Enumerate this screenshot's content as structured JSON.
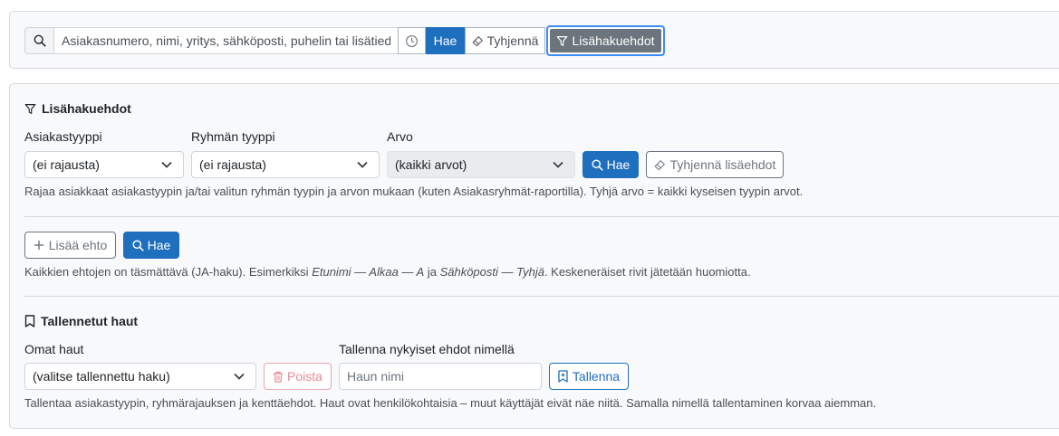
{
  "search": {
    "placeholder": "Asiakasnumero, nimi, yritys, sähköposti, puhelin tai lisätiedot",
    "hae_label": "Hae",
    "clear_label": "Tyhjennä",
    "advanced_label": "Lisähakuehdot"
  },
  "advanced": {
    "title": "Lisähakuehdot",
    "customer_type": {
      "label": "Asiakastyyppi",
      "value": "(ei rajausta)"
    },
    "group_type": {
      "label": "Ryhmän tyyppi",
      "value": "(ei rajausta)"
    },
    "value": {
      "label": "Arvo",
      "value": "(kaikki arvot)"
    },
    "hae_label": "Hae",
    "clear_label": "Tyhjennä lisäehdot",
    "help": "Rajaa asiakkaat asiakastyypin ja/tai valitun ryhmän tyypin ja arvon mukaan (kuten Asiakasryhmät-raportilla). Tyhjä arvo = kaikki kyseisen tyypin arvot."
  },
  "conditions": {
    "add_label": "Lisää ehto",
    "hae_label": "Hae",
    "help_prefix": "Kaikkien ehtojen on täsmättävä (JA-haku). Esimerkiksi ",
    "help_example1": "Etunimi — Alkaa — A",
    "help_middle": " ja ",
    "help_example2": "Sähköposti — Tyhjä",
    "help_suffix": ". Keskeneräiset rivit jätetään huomiotta."
  },
  "saved": {
    "title": "Tallennetut haut",
    "own_label": "Omat haut",
    "own_value": "(valitse tallennettu haku)",
    "delete_label": "Poista",
    "save_as_label": "Tallenna nykyiset ehdot nimellä",
    "name_placeholder": "Haun nimi",
    "save_label": "Tallenna",
    "help": "Tallentaa asiakastyypin, ryhmärajauksen ja kenttäehdot. Haut ovat henkilökohtaisia – muut käyttäjät eivät näe niitä. Samalla nimellä tallentaminen korvaa aiemman."
  },
  "colors": {
    "primary": "#1f6fbf",
    "secondary": "#6c757d",
    "danger_light": "#e78a94",
    "focus": "#3d8bfd"
  },
  "icons": [
    "search-icon",
    "history-icon",
    "eraser-icon",
    "filter-icon",
    "chevron-down-icon",
    "plus-icon",
    "bookmark-icon",
    "trash-icon",
    "bookmark-plus-icon"
  ]
}
